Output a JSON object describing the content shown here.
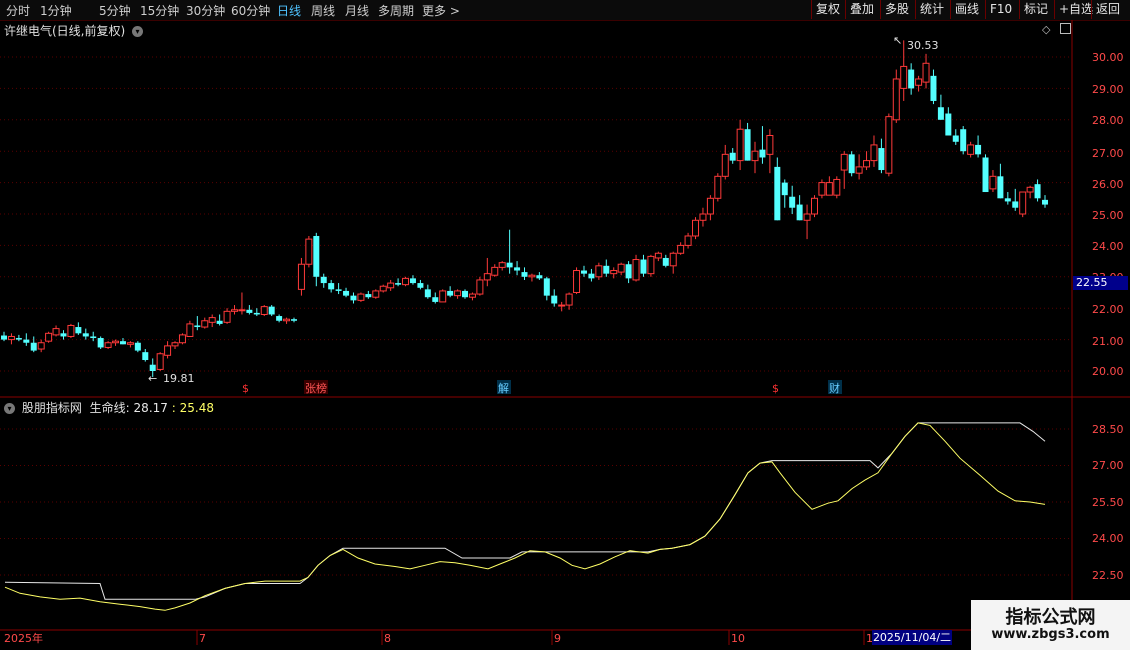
{
  "toolbar": {
    "periods": [
      "分时",
      "1分钟",
      "5分钟",
      "15分钟",
      "30分钟",
      "60分钟",
      "日线",
      "周线",
      "月线",
      "多周期",
      "更多 >"
    ],
    "active": "日线",
    "right": [
      "复权",
      "叠加",
      "多股",
      "统计",
      "画线",
      "F10",
      "标记",
      "+自选",
      "返回"
    ]
  },
  "stock": {
    "title": "许继电气(日线,前复权)",
    "high_label": "30.53",
    "low_label": "19.81",
    "current_price": "22.55"
  },
  "price_axis": [
    "30.00",
    "29.00",
    "28.00",
    "27.00",
    "26.00",
    "25.00",
    "24.00",
    "23.00",
    "22.00",
    "21.00",
    "20.00"
  ],
  "events": {
    "dollar1": "$",
    "zhangbang": "张榜",
    "jie": "解",
    "dollar2": "$",
    "cai": "财"
  },
  "indicator": {
    "name": "股朋指标网",
    "line_name": "生命线:",
    "value1": "28.17",
    "sep": ":",
    "value2": "25.48",
    "axis": [
      "28.50",
      "27.00",
      "25.50",
      "24.00",
      "22.50"
    ]
  },
  "time_axis": [
    "2025年",
    "7",
    "8",
    "9",
    "10",
    "11"
  ],
  "selected_date": "2025/11/04/二",
  "watermark": {
    "line1": "指标公式网",
    "line2": "www.zbgs3.com"
  },
  "colors": {
    "up": "#ff3a3a",
    "down": "#54ffff",
    "grid": "#5a0000",
    "axis": "#7a0000",
    "yellow": "#ffff66",
    "white": "#e8e8e8"
  },
  "chart_data": {
    "type": "candlestick",
    "ylim": [
      19.5,
      30.9
    ],
    "candles": [
      [
        21.13,
        21.25,
        20.95,
        21.0
      ],
      [
        21.0,
        21.2,
        20.85,
        21.1
      ],
      [
        21.05,
        21.15,
        20.95,
        21.0
      ],
      [
        21.0,
        21.2,
        20.8,
        20.9
      ],
      [
        20.9,
        21.1,
        20.6,
        20.65
      ],
      [
        20.7,
        21.0,
        20.6,
        20.9
      ],
      [
        20.95,
        21.25,
        20.9,
        21.2
      ],
      [
        21.15,
        21.45,
        21.1,
        21.35
      ],
      [
        21.2,
        21.3,
        21.0,
        21.1
      ],
      [
        21.1,
        21.5,
        21.05,
        21.45
      ],
      [
        21.4,
        21.55,
        21.15,
        21.2
      ],
      [
        21.2,
        21.35,
        21.0,
        21.1
      ],
      [
        21.1,
        21.25,
        20.95,
        21.05
      ],
      [
        21.05,
        21.1,
        20.7,
        20.75
      ],
      [
        20.75,
        20.95,
        20.7,
        20.9
      ],
      [
        20.9,
        21.0,
        20.8,
        20.95
      ],
      [
        20.95,
        21.05,
        20.85,
        20.85
      ],
      [
        20.85,
        20.95,
        20.75,
        20.9
      ],
      [
        20.9,
        20.95,
        20.6,
        20.65
      ],
      [
        20.6,
        20.7,
        20.3,
        20.35
      ],
      [
        20.2,
        20.4,
        19.81,
        20.0
      ],
      [
        20.05,
        20.6,
        20.0,
        20.55
      ],
      [
        20.5,
        20.95,
        20.4,
        20.8
      ],
      [
        20.8,
        20.95,
        20.7,
        20.9
      ],
      [
        20.9,
        21.2,
        20.85,
        21.15
      ],
      [
        21.1,
        21.6,
        21.1,
        21.5
      ],
      [
        21.45,
        21.75,
        21.3,
        21.4
      ],
      [
        21.4,
        21.7,
        21.35,
        21.6
      ],
      [
        21.55,
        21.8,
        21.4,
        21.7
      ],
      [
        21.6,
        21.8,
        21.45,
        21.5
      ],
      [
        21.55,
        22.0,
        21.5,
        21.9
      ],
      [
        21.9,
        22.1,
        21.8,
        21.95
      ],
      [
        21.95,
        22.5,
        21.8,
        21.95
      ],
      [
        21.95,
        22.1,
        21.8,
        21.85
      ],
      [
        21.85,
        22.0,
        21.75,
        21.8
      ],
      [
        21.8,
        22.1,
        21.75,
        22.05
      ],
      [
        22.05,
        22.1,
        21.75,
        21.8
      ],
      [
        21.75,
        21.8,
        21.55,
        21.6
      ],
      [
        21.6,
        21.7,
        21.5,
        21.65
      ],
      [
        21.65,
        21.7,
        21.55,
        21.6
      ],
      [
        22.6,
        23.6,
        22.4,
        23.4
      ],
      [
        23.4,
        24.3,
        23.3,
        24.2
      ],
      [
        24.3,
        24.4,
        22.7,
        23.0
      ],
      [
        23.0,
        23.1,
        22.65,
        22.8
      ],
      [
        22.8,
        22.9,
        22.5,
        22.6
      ],
      [
        22.6,
        22.8,
        22.45,
        22.55
      ],
      [
        22.55,
        22.65,
        22.35,
        22.4
      ],
      [
        22.4,
        22.5,
        22.15,
        22.25
      ],
      [
        22.25,
        22.5,
        22.2,
        22.45
      ],
      [
        22.45,
        22.55,
        22.3,
        22.35
      ],
      [
        22.35,
        22.6,
        22.3,
        22.55
      ],
      [
        22.55,
        22.75,
        22.5,
        22.7
      ],
      [
        22.65,
        22.9,
        22.55,
        22.8
      ],
      [
        22.8,
        22.95,
        22.7,
        22.75
      ],
      [
        22.75,
        23.0,
        22.7,
        22.95
      ],
      [
        22.95,
        23.05,
        22.75,
        22.8
      ],
      [
        22.8,
        22.9,
        22.6,
        22.65
      ],
      [
        22.6,
        22.75,
        22.3,
        22.35
      ],
      [
        22.35,
        22.5,
        22.15,
        22.2
      ],
      [
        22.2,
        22.6,
        22.2,
        22.55
      ],
      [
        22.55,
        22.7,
        22.35,
        22.4
      ],
      [
        22.4,
        22.6,
        22.3,
        22.55
      ],
      [
        22.55,
        22.6,
        22.3,
        22.35
      ],
      [
        22.35,
        22.5,
        22.25,
        22.45
      ],
      [
        22.45,
        23.0,
        22.4,
        22.9
      ],
      [
        22.9,
        23.6,
        22.7,
        23.1
      ],
      [
        23.05,
        23.4,
        23.0,
        23.3
      ],
      [
        23.3,
        23.5,
        23.2,
        23.45
      ],
      [
        23.45,
        24.5,
        23.1,
        23.3
      ],
      [
        23.3,
        23.5,
        23.05,
        23.2
      ],
      [
        23.15,
        23.3,
        22.9,
        23.0
      ],
      [
        23.0,
        23.1,
        22.85,
        23.05
      ],
      [
        23.05,
        23.15,
        22.9,
        22.95
      ],
      [
        22.95,
        23.0,
        22.25,
        22.4
      ],
      [
        22.4,
        22.6,
        22.05,
        22.15
      ],
      [
        22.1,
        22.2,
        21.9,
        22.1
      ],
      [
        22.1,
        22.5,
        21.95,
        22.45
      ],
      [
        22.5,
        23.3,
        22.45,
        23.2
      ],
      [
        23.2,
        23.35,
        23.0,
        23.1
      ],
      [
        23.1,
        23.25,
        22.85,
        22.95
      ],
      [
        23.0,
        23.45,
        22.9,
        23.35
      ],
      [
        23.35,
        23.55,
        23.0,
        23.1
      ],
      [
        23.1,
        23.3,
        22.95,
        23.2
      ],
      [
        23.15,
        23.45,
        23.05,
        23.4
      ],
      [
        23.4,
        23.5,
        22.8,
        22.95
      ],
      [
        22.9,
        23.7,
        22.85,
        23.55
      ],
      [
        23.55,
        23.7,
        23.0,
        23.1
      ],
      [
        23.1,
        23.7,
        23.0,
        23.65
      ],
      [
        23.6,
        23.8,
        23.5,
        23.75
      ],
      [
        23.6,
        23.7,
        23.3,
        23.35
      ],
      [
        23.35,
        23.8,
        23.1,
        23.75
      ],
      [
        23.75,
        24.1,
        23.7,
        24.0
      ],
      [
        24.0,
        24.4,
        23.9,
        24.3
      ],
      [
        24.3,
        24.9,
        24.2,
        24.8
      ],
      [
        24.8,
        25.2,
        24.6,
        25.0
      ],
      [
        25.0,
        25.6,
        24.8,
        25.5
      ],
      [
        25.5,
        26.3,
        25.4,
        26.2
      ],
      [
        26.2,
        27.2,
        26.1,
        26.9
      ],
      [
        26.95,
        27.1,
        26.6,
        26.7
      ],
      [
        26.7,
        28.0,
        26.4,
        27.7
      ],
      [
        27.7,
        27.9,
        26.7,
        26.7
      ],
      [
        26.7,
        27.3,
        26.3,
        27.0
      ],
      [
        27.05,
        27.8,
        26.6,
        26.8
      ],
      [
        26.9,
        27.7,
        26.3,
        27.5
      ],
      [
        26.5,
        26.8,
        24.8,
        24.8
      ],
      [
        26.0,
        26.1,
        25.2,
        25.6
      ],
      [
        25.55,
        25.9,
        25.0,
        25.2
      ],
      [
        25.3,
        25.6,
        24.8,
        24.8
      ],
      [
        24.8,
        25.3,
        24.2,
        25.0
      ],
      [
        25.0,
        25.6,
        24.9,
        25.5
      ],
      [
        25.6,
        26.1,
        25.5,
        26.0
      ],
      [
        25.6,
        26.2,
        25.6,
        26.0
      ],
      [
        25.6,
        26.2,
        25.5,
        26.1
      ],
      [
        26.4,
        27.0,
        25.8,
        26.9
      ],
      [
        26.9,
        27.0,
        26.2,
        26.3
      ],
      [
        26.3,
        26.9,
        26.1,
        26.5
      ],
      [
        26.5,
        27.0,
        26.4,
        26.7
      ],
      [
        26.7,
        27.5,
        26.5,
        27.2
      ],
      [
        27.1,
        27.4,
        26.3,
        26.4
      ],
      [
        26.3,
        28.2,
        26.2,
        28.1
      ],
      [
        28.0,
        29.6,
        27.9,
        29.3
      ],
      [
        29.0,
        30.53,
        28.6,
        29.7
      ],
      [
        29.6,
        29.8,
        28.8,
        29.0
      ],
      [
        29.1,
        29.4,
        28.9,
        29.3
      ],
      [
        29.2,
        30.1,
        29.0,
        29.8
      ],
      [
        29.4,
        29.6,
        28.5,
        28.6
      ],
      [
        28.4,
        28.8,
        28.0,
        28.0
      ],
      [
        28.2,
        28.4,
        27.5,
        27.5
      ],
      [
        27.5,
        27.7,
        27.2,
        27.3
      ],
      [
        27.7,
        27.8,
        26.9,
        27.0
      ],
      [
        26.9,
        27.3,
        26.8,
        27.2
      ],
      [
        27.2,
        27.5,
        26.8,
        26.9
      ],
      [
        26.8,
        26.9,
        25.7,
        25.7
      ],
      [
        25.8,
        26.4,
        25.7,
        26.2
      ],
      [
        26.2,
        26.6,
        25.5,
        25.5
      ],
      [
        25.5,
        25.7,
        25.3,
        25.4
      ],
      [
        25.4,
        25.8,
        25.1,
        25.2
      ],
      [
        25.0,
        25.7,
        24.9,
        25.7
      ],
      [
        25.7,
        25.9,
        25.5,
        25.85
      ],
      [
        25.95,
        26.1,
        25.4,
        25.5
      ],
      [
        25.45,
        25.6,
        25.2,
        25.3
      ]
    ],
    "indicator_ylim": [
      21.6,
      29.2
    ],
    "lifeline_yellow": [
      [
        5,
        22.0
      ],
      [
        20,
        21.75
      ],
      [
        40,
        21.6
      ],
      [
        60,
        21.5
      ],
      [
        80,
        21.55
      ],
      [
        100,
        21.4
      ],
      [
        120,
        21.3
      ],
      [
        140,
        21.2
      ],
      [
        155,
        21.1
      ],
      [
        165,
        21.05
      ],
      [
        175,
        21.15
      ],
      [
        190,
        21.35
      ],
      [
        205,
        21.65
      ],
      [
        225,
        21.95
      ],
      [
        245,
        22.15
      ],
      [
        265,
        22.25
      ],
      [
        285,
        22.25
      ],
      [
        300,
        22.25
      ],
      [
        308,
        22.4
      ],
      [
        318,
        22.9
      ],
      [
        330,
        23.3
      ],
      [
        343,
        23.55
      ],
      [
        358,
        23.2
      ],
      [
        375,
        22.95
      ],
      [
        395,
        22.85
      ],
      [
        410,
        22.75
      ],
      [
        425,
        22.9
      ],
      [
        440,
        23.05
      ],
      [
        455,
        23.0
      ],
      [
        470,
        22.9
      ],
      [
        488,
        22.75
      ],
      [
        500,
        22.95
      ],
      [
        515,
        23.2
      ],
      [
        530,
        23.5
      ],
      [
        545,
        23.45
      ],
      [
        560,
        23.2
      ],
      [
        572,
        22.9
      ],
      [
        585,
        22.75
      ],
      [
        600,
        22.95
      ],
      [
        615,
        23.25
      ],
      [
        630,
        23.5
      ],
      [
        648,
        23.4
      ],
      [
        660,
        23.55
      ],
      [
        672,
        23.6
      ],
      [
        690,
        23.75
      ],
      [
        705,
        24.1
      ],
      [
        720,
        24.8
      ],
      [
        735,
        25.8
      ],
      [
        748,
        26.7
      ],
      [
        760,
        27.1
      ],
      [
        772,
        27.15
      ],
      [
        780,
        26.7
      ],
      [
        795,
        25.9
      ],
      [
        812,
        25.2
      ],
      [
        828,
        25.45
      ],
      [
        838,
        25.55
      ],
      [
        852,
        26.05
      ],
      [
        865,
        26.4
      ],
      [
        878,
        26.7
      ],
      [
        892,
        27.5
      ],
      [
        905,
        28.2
      ],
      [
        918,
        28.75
      ],
      [
        930,
        28.65
      ],
      [
        945,
        28.0
      ],
      [
        960,
        27.3
      ],
      [
        980,
        26.6
      ],
      [
        998,
        25.95
      ],
      [
        1015,
        25.55
      ],
      [
        1030,
        25.5
      ],
      [
        1045,
        25.4
      ]
    ],
    "lifeline_white": [
      [
        5,
        22.2
      ],
      [
        100,
        22.15
      ],
      [
        105,
        21.5
      ],
      [
        195,
        21.5
      ],
      [
        205,
        21.6
      ],
      [
        225,
        21.95
      ],
      [
        245,
        22.15
      ],
      [
        300,
        22.15
      ],
      [
        308,
        22.4
      ],
      [
        318,
        22.9
      ],
      [
        330,
        23.3
      ],
      [
        343,
        23.6
      ],
      [
        445,
        23.6
      ],
      [
        462,
        23.2
      ],
      [
        510,
        23.2
      ],
      [
        522,
        23.45
      ],
      [
        648,
        23.45
      ],
      [
        660,
        23.55
      ],
      [
        672,
        23.6
      ],
      [
        690,
        23.75
      ],
      [
        705,
        24.1
      ],
      [
        720,
        24.8
      ],
      [
        735,
        25.8
      ],
      [
        748,
        26.7
      ],
      [
        760,
        27.1
      ],
      [
        772,
        27.2
      ],
      [
        870,
        27.2
      ],
      [
        878,
        26.9
      ],
      [
        892,
        27.5
      ],
      [
        905,
        28.2
      ],
      [
        918,
        28.75
      ],
      [
        1020,
        28.75
      ],
      [
        1033,
        28.4
      ],
      [
        1045,
        28.0
      ]
    ]
  }
}
